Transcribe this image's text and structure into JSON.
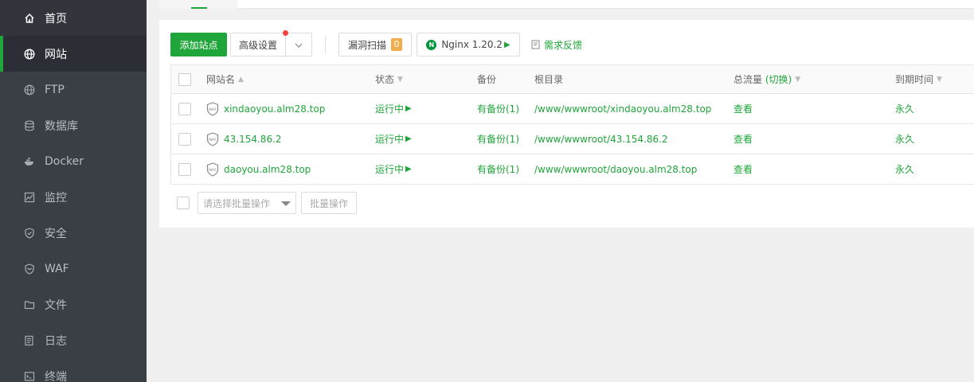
{
  "sidebar": {
    "items": [
      {
        "label": "首页",
        "icon": "home-icon"
      },
      {
        "label": "网站",
        "icon": "globe-icon"
      },
      {
        "label": "FTP",
        "icon": "globe-icon"
      },
      {
        "label": "数据库",
        "icon": "database-icon"
      },
      {
        "label": "Docker",
        "icon": "docker-icon"
      },
      {
        "label": "监控",
        "icon": "monitor-icon"
      },
      {
        "label": "安全",
        "icon": "shield-check-icon"
      },
      {
        "label": "WAF",
        "icon": "waf-shield-icon"
      },
      {
        "label": "文件",
        "icon": "folder-icon"
      },
      {
        "label": "日志",
        "icon": "log-icon"
      },
      {
        "label": "终端",
        "icon": "terminal-icon"
      }
    ],
    "accent": "#20a53a",
    "background": "#3a3e45"
  },
  "toolbar": {
    "add_site": "添加站点",
    "advanced": "高级设置",
    "scan": "漏洞扫描",
    "scan_count": "0",
    "nginx": "Nginx 1.20.2",
    "feedback": "需求反馈"
  },
  "table": {
    "headers": {
      "name": "网站名",
      "status": "状态",
      "backup": "备份",
      "root": "根目录",
      "traffic": "总流量",
      "traffic_switch": "(切换)",
      "expire": "到期时间"
    },
    "rows": [
      {
        "name": "xindaoyou.alm28.top",
        "status": "运行中",
        "backup": "有备份(1)",
        "root": "/www/wwwroot/xindaoyou.alm28.top",
        "traffic": "查看",
        "expire": "永久"
      },
      {
        "name": "43.154.86.2",
        "status": "运行中",
        "backup": "有备份(1)",
        "root": "/www/wwwroot/43.154.86.2",
        "traffic": "查看",
        "expire": "永久"
      },
      {
        "name": "daoyou.alm28.top",
        "status": "运行中",
        "backup": "有备份(1)",
        "root": "/www/wwwroot/daoyou.alm28.top",
        "traffic": "查看",
        "expire": "永久"
      }
    ]
  },
  "batch": {
    "placeholder": "请选择批量操作",
    "button": "批量操作"
  }
}
